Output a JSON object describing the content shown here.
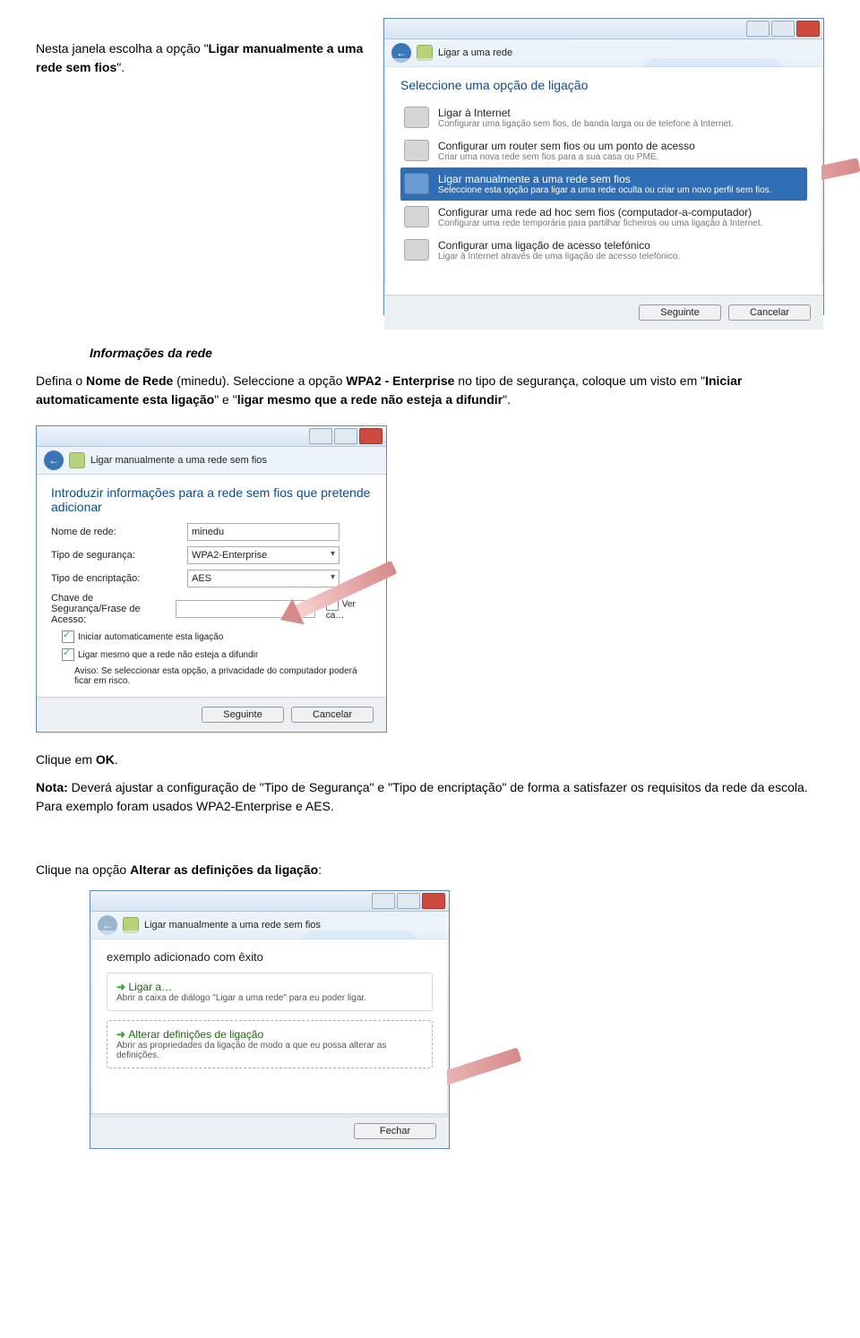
{
  "doc": {
    "intro_p1_a": "Nesta janela escolha a opção \"",
    "intro_p1_b": "Ligar manualmente a uma rede sem fios",
    "intro_p1_c": "\".",
    "section_title": "Informações da rede",
    "intro_p2_a": "Defina o ",
    "intro_p2_b": "Nome de Rede",
    "intro_p2_c": " (minedu). Seleccione a opção ",
    "intro_p2_d": "WPA2 - Enterprise",
    "intro_p2_e": " no tipo de segurança, coloque um visto em \"",
    "intro_p2_f": "Iniciar automaticamente esta ligação",
    "intro_p2_g": "\" e \"",
    "intro_p2_h": "ligar mesmo que a rede não esteja a difundir",
    "intro_p2_i": "\".",
    "click_ok_a": "Clique em ",
    "click_ok_b": "OK",
    "click_ok_c": ".",
    "note_a": "Nota:",
    "note_b": " Deverá ajustar a configuração de \"Tipo de Segurança\" e \"Tipo de encriptação\" de forma a satisfazer os requisitos da rede da escola. Para exemplo foram usados WPA2-Enterprise e AES.",
    "click_alt_a": "Clique na opção ",
    "click_alt_b": "Alterar as definições da ligação",
    "click_alt_c": ":"
  },
  "dlg1": {
    "nav": "Ligar a uma rede",
    "prompt": "Seleccione uma opção de ligação",
    "opts": {
      "o0": {
        "t": "Ligar à Internet",
        "s": "Configurar uma ligação sem fios, de banda larga ou de telefone à Internet."
      },
      "o1": {
        "t": "Configurar um router sem fios ou um ponto de acesso",
        "s": "Criar uma nova rede sem fios para a sua casa ou PME."
      },
      "o2": {
        "t": "Ligar manualmente a uma rede sem fios",
        "s": "Seleccione esta opção para ligar a uma rede oculta ou criar um novo perfil sem fios."
      },
      "o3": {
        "t": "Configurar uma rede ad hoc sem fios (computador-a-computador)",
        "s": "Configurar uma rede temporária para partilhar ficheiros ou uma ligação à Internet."
      },
      "o4": {
        "t": "Configurar uma ligação de acesso telefónico",
        "s": "Ligar à Internet através de uma ligação de acesso telefónico."
      }
    },
    "btn_next": "Seguinte",
    "btn_cancel": "Cancelar"
  },
  "dlg2": {
    "nav": "Ligar manualmente a uma rede sem fios",
    "prompt": "Introduzir informações para a rede sem fios que pretende adicionar",
    "l_name": "Nome de rede:",
    "v_name": "minedu",
    "l_sec": "Tipo de segurança:",
    "v_sec": "WPA2-Enterprise",
    "l_enc": "Tipo de encriptação:",
    "v_enc": "AES",
    "l_key": "Chave de Segurança/Frase de Acesso:",
    "chk_show": "Ver ca…",
    "chk_auto": "Iniciar automaticamente esta ligação",
    "chk_hidden": "Ligar mesmo que a rede não esteja a difundir",
    "warn": "Aviso: Se seleccionar esta opção, a privacidade do computador poderá ficar em risco.",
    "btn_next": "Seguinte",
    "btn_cancel": "Cancelar"
  },
  "dlg3": {
    "nav": "Ligar manualmente a uma rede sem fios",
    "prompt": "exemplo adicionado com êxito",
    "opt1_t": "Ligar a…",
    "opt1_s": "Abrir a caixa de diálogo \"Ligar a uma rede\" para eu poder ligar.",
    "opt2_t": "Alterar definições de ligação",
    "opt2_s": "Abrir as propriedades da ligação de modo a que eu possa alterar as definições.",
    "btn_close": "Fechar"
  }
}
